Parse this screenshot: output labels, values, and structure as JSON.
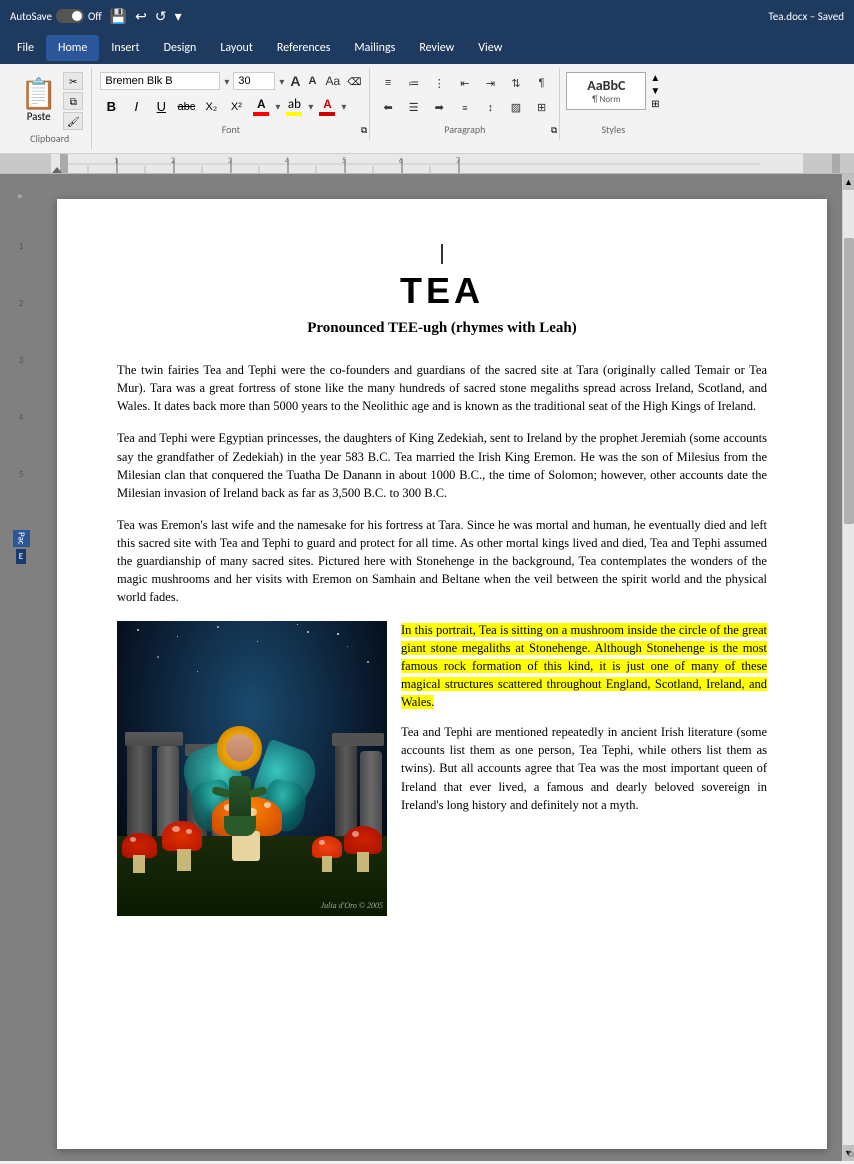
{
  "titlebar": {
    "autosave_label": "AutoSave",
    "toggle_label": "Off",
    "filename": "Tea.docx – Saved",
    "icons": [
      "save",
      "undo",
      "redo",
      "more"
    ]
  },
  "menubar": {
    "items": [
      {
        "label": "File",
        "active": false
      },
      {
        "label": "Home",
        "active": true
      },
      {
        "label": "Insert",
        "active": false
      },
      {
        "label": "Design",
        "active": false
      },
      {
        "label": "Layout",
        "active": false
      },
      {
        "label": "References",
        "active": false
      },
      {
        "label": "Mailings",
        "active": false
      },
      {
        "label": "Review",
        "active": false
      },
      {
        "label": "View",
        "active": false
      }
    ]
  },
  "ribbon": {
    "clipboard_label": "Clipboard",
    "font_label": "Font",
    "paragraph_label": "Paragraph",
    "styles_label": "Styles",
    "paste_label": "Paste",
    "font_name": "Bremen Blk B",
    "font_size": "30",
    "style_name": "¶ Norm"
  },
  "document": {
    "title": "TEA",
    "subtitle": "Pronounced TEE-ugh (rhymes with Leah)",
    "para1": "The twin fairies Tea and Tephi were the co-founders and guardians of the sacred site at Tara (originally called Temair or Tea Mur). Tara was a great fortress of stone like the many hundreds of sacred stone megaliths spread across Ireland, Scotland, and Wales. It dates back more than 5000 years to the Neolithic age and is known as the traditional seat of the High Kings of Ireland.",
    "para2": "Tea and Tephi were Egyptian princesses, the daughters of King Zedekiah, sent to Ireland by the prophet Jeremiah (some accounts say the grandfather of Zedekiah) in the year 583 B.C. Tea married the Irish King Eremon. He was the son of Milesius from the Milesian clan that conquered the Tuatha De Danann in about 1000 B.C., the time of Solomon; however, other accounts date the Milesian invasion of Ireland back as far as 3,500 B.C. to 300 B.C.",
    "para3": "Tea was Eremon's last wife and the namesake for his fortress at Tara. Since he was mortal and human, he eventually died and left this sacred site with Tea and Tephi to guard and protect for all time. As other mortal kings lived and died, Tea and Tephi assumed the guardianship of many sacred sites. Pictured here with Stonehenge in the background, Tea contemplates the wonders of the magic mushrooms and her visits with Eremon on Samhain and Beltane when the veil between the spirit world and the physical world fades.",
    "highlighted_para": "In this portrait, Tea is sitting on a mushroom inside the circle of the great giant stone megaliths at Stonehenge. Although Stonehenge is the most famous rock formation of this kind, it is just one of many of these magical structures scattered throughout England, Scotland, Ireland, and Wales.",
    "para4": "Tea and Tephi are mentioned repeatedly in ancient Irish literature (some accounts list them as one person, Tea Tephi, while others list them as twins). But all accounts agree that Tea was the most important queen of Ireland that ever lived, a famous and dearly beloved sovereign in Ireland's long history and definitely not a myth.",
    "image_credit": "Julia d'Oro © 2005"
  }
}
